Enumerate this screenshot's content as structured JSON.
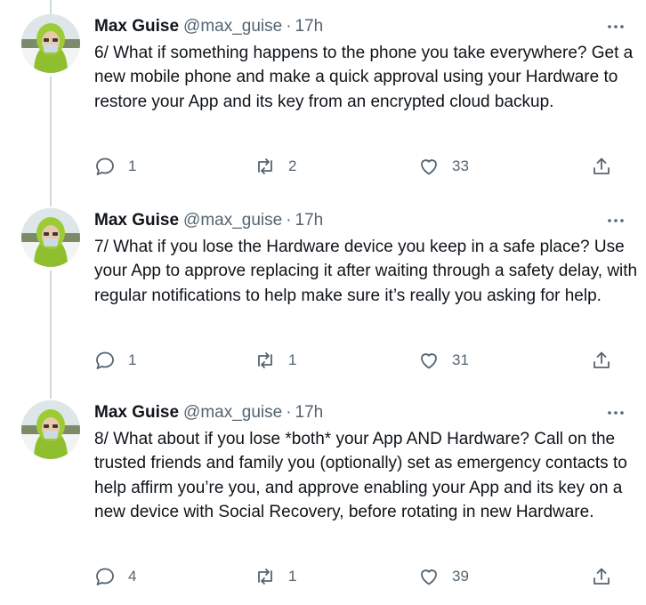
{
  "colors": {
    "text": "#0f1419",
    "secondary": "#536471",
    "thread_line": "#cfd9de",
    "background": "#ffffff"
  },
  "tweets": [
    {
      "name": "Max Guise",
      "handle": "@max_guise",
      "separator": "·",
      "time": "17h",
      "text": "6/ What if something happens to the phone you take everywhere? Get a new mobile phone and make a quick approval using your Hardware to restore your App and its key from an encrypted cloud backup.",
      "replies": "1",
      "retweets": "2",
      "likes": "33",
      "icons": {
        "reply": "reply-icon",
        "retweet": "retweet-icon",
        "like": "heart-icon",
        "share": "share-icon",
        "more": "more-icon"
      }
    },
    {
      "name": "Max Guise",
      "handle": "@max_guise",
      "separator": "·",
      "time": "17h",
      "text": "7/ What if you lose the Hardware device you keep in a safe place? Use your App to approve replacing it after waiting through a safety delay, with regular notifications to help make sure it’s really you asking for help.",
      "replies": "1",
      "retweets": "1",
      "likes": "31",
      "icons": {
        "reply": "reply-icon",
        "retweet": "retweet-icon",
        "like": "heart-icon",
        "share": "share-icon",
        "more": "more-icon"
      }
    },
    {
      "name": "Max Guise",
      "handle": "@max_guise",
      "separator": "·",
      "time": "17h",
      "text": "8/ What about if you lose *both* your App AND Hardware? Call on the trusted friends and family you (optionally) set as emergency contacts to help affirm you’re you, and approve enabling your App and its key on a new device with Social Recovery, before rotating in new Hardware.",
      "replies": "4",
      "retweets": "1",
      "likes": "39",
      "icons": {
        "reply": "reply-icon",
        "retweet": "retweet-icon",
        "like": "heart-icon",
        "share": "share-icon",
        "more": "more-icon"
      }
    }
  ]
}
